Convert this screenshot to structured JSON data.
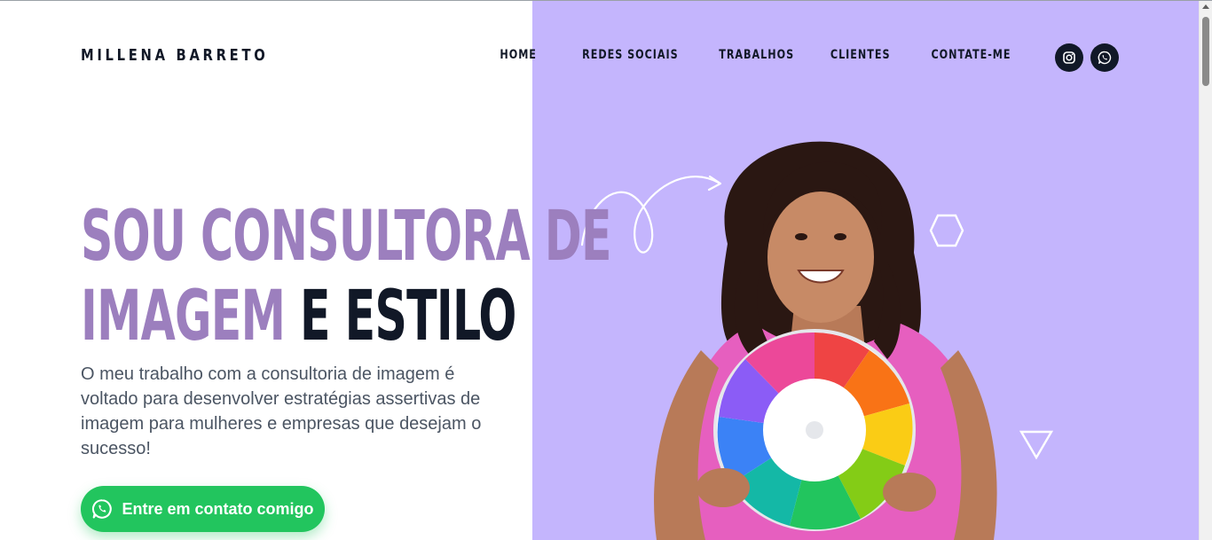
{
  "header": {
    "brand": "MILLENA BARRETO",
    "nav": [
      {
        "label": "HOME"
      },
      {
        "label": "REDES SOCIAIS"
      },
      {
        "label": "TRABALHOS"
      },
      {
        "label": "CLIENTES"
      },
      {
        "label": "CONTATE-ME"
      }
    ],
    "social": [
      {
        "icon": "instagram-icon"
      },
      {
        "icon": "whatsapp-icon"
      }
    ]
  },
  "hero": {
    "headline_line1": "SOU CONSULTORA DE",
    "headline_line2_accent": "IMAGEM",
    "headline_line2_dark": " E ESTILO",
    "intro": "O meu trabalho com a consultoria de imagem é voltado para desenvolver estratégias assertivas de imagem para mulheres e empresas que desejam o sucesso!",
    "cta_label": "Entre em contato comigo",
    "cta_icon": "whatsapp-icon"
  },
  "colors": {
    "panel": "#c4b5fd",
    "accent": "#9c7fbe",
    "dark": "#111827",
    "cta": "#22c55e"
  }
}
